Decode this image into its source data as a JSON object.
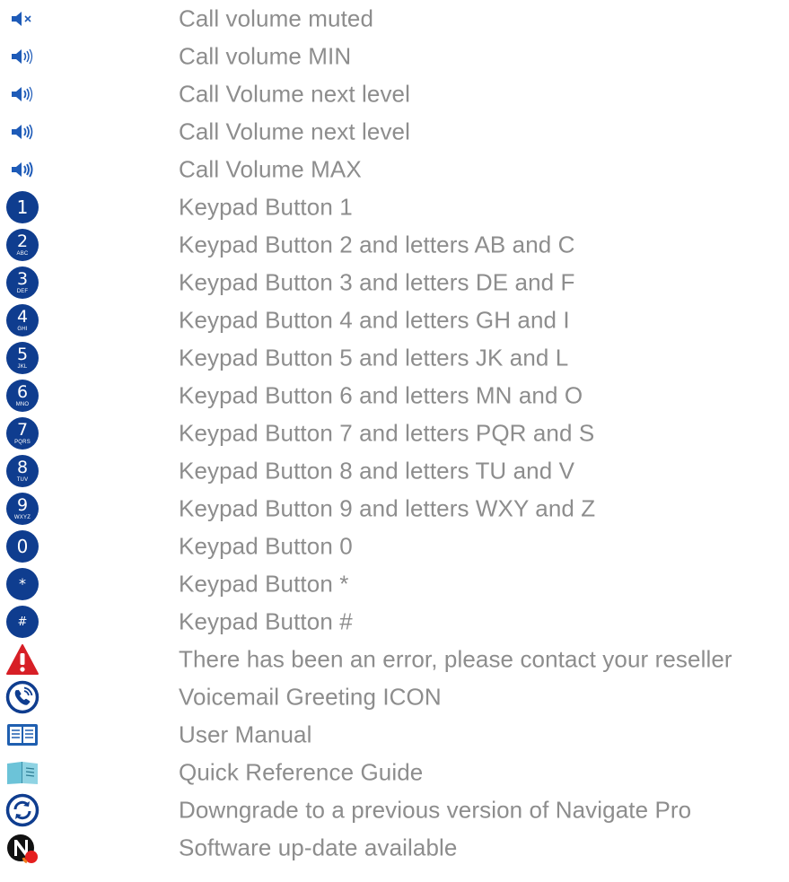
{
  "legend": {
    "items": [
      {
        "icon": "speaker-muted-icon",
        "label": "Call volume muted"
      },
      {
        "icon": "speaker-min-icon",
        "label": "Call volume MIN"
      },
      {
        "icon": "speaker-level-2-icon",
        "label": "Call Volume next level"
      },
      {
        "icon": "speaker-level-3-icon",
        "label": "Call Volume next level"
      },
      {
        "icon": "speaker-max-icon",
        "label": "Call Volume MAX"
      },
      {
        "icon": "keypad-1-icon",
        "label": "Keypad Button 1",
        "digit": "1",
        "letters": ""
      },
      {
        "icon": "keypad-2-icon",
        "label": "Keypad Button 2 and letters AB and C",
        "digit": "2",
        "letters": "ABC"
      },
      {
        "icon": "keypad-3-icon",
        "label": "Keypad Button 3 and letters DE and F",
        "digit": "3",
        "letters": "DEF"
      },
      {
        "icon": "keypad-4-icon",
        "label": "Keypad Button 4 and letters GH and I",
        "digit": "4",
        "letters": "GHI"
      },
      {
        "icon": "keypad-5-icon",
        "label": "Keypad Button 5 and letters JK and L",
        "digit": "5",
        "letters": "JKL"
      },
      {
        "icon": "keypad-6-icon",
        "label": "Keypad Button 6 and letters MN and O",
        "digit": "6",
        "letters": "MNO"
      },
      {
        "icon": "keypad-7-icon",
        "label": "Keypad Button 7 and letters PQR and S",
        "digit": "7",
        "letters": "PQRS"
      },
      {
        "icon": "keypad-8-icon",
        "label": "Keypad Button 8 and letters TU and V",
        "digit": "8",
        "letters": "TUV"
      },
      {
        "icon": "keypad-9-icon",
        "label": "Keypad Button 9 and letters WXY and Z",
        "digit": "9",
        "letters": "WXYZ"
      },
      {
        "icon": "keypad-0-icon",
        "label": "Keypad Button 0",
        "digit": "0",
        "letters": ""
      },
      {
        "icon": "keypad-star-icon",
        "label": "Keypad Button *",
        "digit": "*",
        "letters": ""
      },
      {
        "icon": "keypad-hash-icon",
        "label": "Keypad Button #",
        "digit": "#",
        "letters": ""
      },
      {
        "icon": "error-warning-icon",
        "label": "There has been an error, please contact your reseller"
      },
      {
        "icon": "voicemail-greeting-icon",
        "label": "Voicemail Greeting ICON"
      },
      {
        "icon": "user-manual-icon",
        "label": "User Manual"
      },
      {
        "icon": "quick-reference-guide-icon",
        "label": "Quick Reference Guide"
      },
      {
        "icon": "downgrade-icon",
        "label": "Downgrade to a previous version of Navigate Pro"
      },
      {
        "icon": "software-update-icon",
        "label": "Software up-date available"
      }
    ]
  },
  "colors": {
    "label_text": "#8d8d8d",
    "keypad_blue": "#0f3d8f",
    "speaker_blue": "#1e5bb8",
    "error_red": "#d71f26",
    "manual_blue": "#1f5fb0",
    "guide_teal": "#6cc3d8",
    "update_orange": "#f07a1a"
  }
}
